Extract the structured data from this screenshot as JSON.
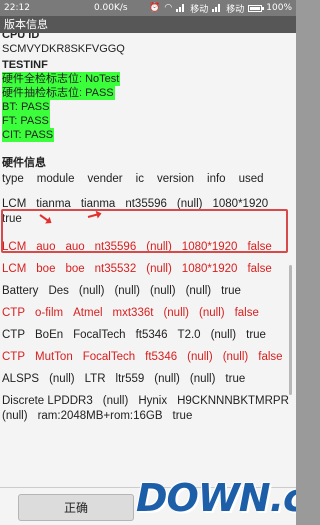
{
  "status_bar": {
    "time": "22:12",
    "speed": "0.00K/s",
    "carrier1": "移动",
    "carrier2": "移动",
    "battery": "100%",
    "icons": [
      "alarm-icon",
      "wifi-icon",
      "signal-icon",
      "signal-icon",
      "battery-icon"
    ]
  },
  "dialog": {
    "title": "版本信息",
    "cpuid_label": "CPU ID",
    "cpuid_value": "SCMVYDKR8SKFVGGQ",
    "testinf_label": "TESTINF",
    "test_lines": [
      "硬件全检标志位: NoTest",
      "硬件抽检标志位: PASS",
      "BT: PASS",
      "FT: PASS",
      "CIT: PASS"
    ],
    "hw_title": "硬件信息",
    "columns": [
      "type",
      "module",
      "vender",
      "ic",
      "version",
      "info",
      "used"
    ],
    "rows": [
      {
        "cells": [
          "LCM",
          "tianma",
          "tianma",
          "nt35596",
          "(null)",
          "1080*1920",
          "true"
        ],
        "color": "black",
        "highlight": true
      },
      {
        "cells": [
          "LCM",
          "auo",
          "auo",
          "nt35596",
          "(null)",
          "1080*1920",
          "false"
        ],
        "color": "red"
      },
      {
        "cells": [
          "LCM",
          "boe",
          "boe",
          "nt35532",
          "(null)",
          "1080*1920",
          "false"
        ],
        "color": "red"
      },
      {
        "cells": [
          "Battery",
          "Des",
          "(null)",
          "(null)",
          "(null)",
          "(null)",
          "true"
        ],
        "color": "black"
      },
      {
        "cells": [
          "CTP",
          "o-film",
          "Atmel",
          "mxt336t",
          "(null)",
          "(null)",
          "false"
        ],
        "color": "red"
      },
      {
        "cells": [
          "CTP",
          "BoEn",
          "FocalTech",
          "ft5346",
          "T2.0",
          "(null)",
          "true"
        ],
        "color": "black"
      },
      {
        "cells": [
          "CTP",
          "MutTon",
          "FocalTech",
          "ft5346",
          "(null)",
          "(null)",
          "false"
        ],
        "color": "red"
      },
      {
        "cells": [
          "ALSPS",
          "(null)",
          "LTR",
          "ltr559",
          "(null)",
          "(null)",
          "true"
        ],
        "color": "black"
      },
      {
        "cells": [
          "Discrete LPDDR3",
          "(null)",
          "Hynix",
          "H9CKNNNBKTMRPR",
          "(null)",
          "ram:2048MB+rom:16GB",
          "true"
        ],
        "color": "black"
      }
    ],
    "ok_label": "正确"
  },
  "watermark": {
    "text": "DOWN.cc"
  }
}
